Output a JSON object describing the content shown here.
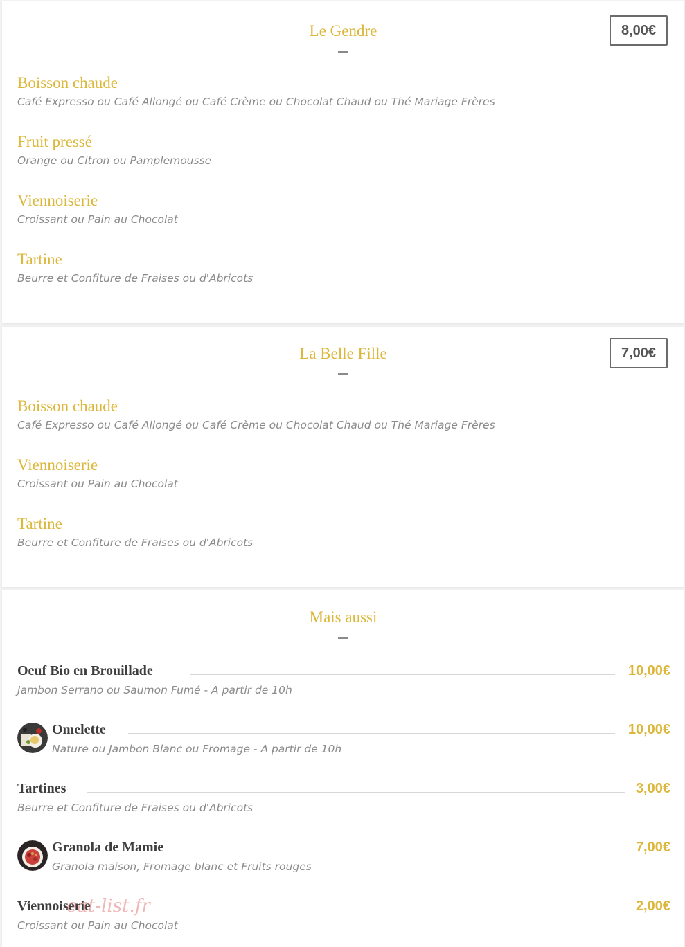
{
  "sections": [
    {
      "title": "Le Gendre",
      "price": "8,00€",
      "items": [
        {
          "name": "Boisson chaude",
          "desc": "Café Expresso ou Café Allongé ou Café Crème ou Chocolat Chaud ou Thé Mariage Frères"
        },
        {
          "name": "Fruit pressé",
          "desc": "Orange ou Citron ou Pamplemousse"
        },
        {
          "name": "Viennoiserie",
          "desc": "Croissant ou Pain au Chocolat"
        },
        {
          "name": "Tartine",
          "desc": "Beurre et Confiture de Fraises ou d'Abricots"
        }
      ]
    },
    {
      "title": "La Belle Fille",
      "price": "7,00€",
      "items": [
        {
          "name": "Boisson chaude",
          "desc": "Café Expresso ou Café Allongé ou Café Crème ou Chocolat Chaud ou Thé Mariage Frères"
        },
        {
          "name": "Viennoiserie",
          "desc": "Croissant ou Pain au Chocolat"
        },
        {
          "name": "Tartine",
          "desc": "Beurre et Confiture de Fraises ou d'Abricots"
        }
      ]
    }
  ],
  "extras": {
    "title": "Mais aussi",
    "items": [
      {
        "name": "Oeuf Bio en Brouillade",
        "price": "10,00€",
        "desc": "Jambon Serrano ou Saumon Fumé - A partir de 10h",
        "photo": false
      },
      {
        "name": "Omelette",
        "price": "10,00€",
        "desc": "Nature ou Jambon Blanc ou Fromage - A partir de 10h",
        "photo": true
      },
      {
        "name": "Tartines",
        "price": "3,00€",
        "desc": "Beurre et Confiture de Fraises ou d'Abricots",
        "photo": false
      },
      {
        "name": "Granola de Mamie",
        "price": "7,00€",
        "desc": "Granola maison, Fromage blanc et Fruits rouges",
        "photo": true
      },
      {
        "name": "Viennoiserie",
        "price": "2,00€",
        "desc": "Croissant ou Pain au Chocolat",
        "photo": false
      }
    ]
  },
  "watermark": "eat-list.fr",
  "colors": {
    "accent": "#dcb73a",
    "text_dark": "#3e3e3e",
    "text_muted": "#8a8a8a",
    "border": "#6b6b6b"
  }
}
